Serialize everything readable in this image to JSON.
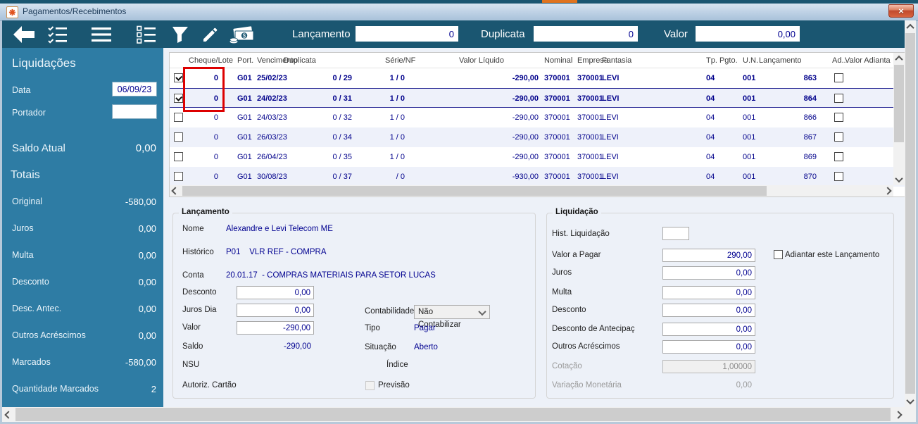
{
  "window": {
    "title": "Pagamentos/Recebimentos",
    "close_glyph": "×"
  },
  "colors": {
    "toolbar_teal": "#1a5671",
    "sidebar_teal": "#2e7ca4",
    "data_navy": "#00008b",
    "annotation_red": "#dd0000",
    "accent_orange": "#e0731e"
  },
  "toolbar": {
    "lancamento_label": "Lançamento",
    "lancamento_value": "0",
    "duplicata_label": "Duplicata",
    "duplicata_value": "0",
    "valor_label": "Valor",
    "valor_value": "0,00"
  },
  "sidebar": {
    "title": "Liquidações",
    "data_label": "Data",
    "data_value": "06/09/23",
    "portador_label": "Portador",
    "portador_value": "",
    "saldo_label": "Saldo Atual",
    "saldo_value": "0,00",
    "totais_title": "Totais",
    "totals": [
      {
        "label": "Original",
        "value": "-580,00"
      },
      {
        "label": "Juros",
        "value": "0,00"
      },
      {
        "label": "Multa",
        "value": "0,00"
      },
      {
        "label": "Desconto",
        "value": "0,00"
      },
      {
        "label": "Desc. Antec.",
        "value": "0,00"
      },
      {
        "label": "Outros Acréscimos",
        "value": "0,00"
      },
      {
        "label": "Marcados",
        "value": "-580,00"
      },
      {
        "label": "Quantidade Marcados",
        "value": "2"
      }
    ]
  },
  "grid": {
    "headers": {
      "cheque": "Cheque/Lote",
      "port": "Port.",
      "venc": "Vencimento",
      "dup": "Duplicata",
      "serie": "Série/NF",
      "valor": "Valor Líquido",
      "nominal": "Nominal",
      "empresa": "Empresa",
      "fantasia": "Fantasia",
      "tp": "Tp. Pgto.",
      "un": "U.N.",
      "lanc": "Lançamento",
      "ad": "Ad...",
      "valad": "Valor Adianta"
    },
    "rows": [
      {
        "checked": true,
        "bold": true,
        "selected": false,
        "cheque": "0",
        "port": "G01",
        "venc": "25/02/23",
        "dup": "0 / 29",
        "serie": "1 / 0",
        "valor": "-290,00",
        "nominal": "370001",
        "empresa": "370001",
        "fantasia": "LEVI",
        "tp": "04",
        "un": "001",
        "lanc": "863"
      },
      {
        "checked": true,
        "bold": true,
        "selected": true,
        "cheque": "0",
        "port": "G01",
        "venc": "24/02/23",
        "dup": "0 / 31",
        "serie": "1 / 0",
        "valor": "-290,00",
        "nominal": "370001",
        "empresa": "370001",
        "fantasia": "LEVI",
        "tp": "04",
        "un": "001",
        "lanc": "864"
      },
      {
        "checked": false,
        "bold": false,
        "selected": false,
        "cheque": "0",
        "port": "G01",
        "venc": "24/03/23",
        "dup": "0 / 32",
        "serie": "1 / 0",
        "valor": "-290,00",
        "nominal": "370001",
        "empresa": "370001",
        "fantasia": "LEVI",
        "tp": "04",
        "un": "001",
        "lanc": "866"
      },
      {
        "checked": false,
        "bold": false,
        "selected": false,
        "cheque": "0",
        "port": "G01",
        "venc": "26/03/23",
        "dup": "0 / 34",
        "serie": "1 / 0",
        "valor": "-290,00",
        "nominal": "370001",
        "empresa": "370001",
        "fantasia": "LEVI",
        "tp": "04",
        "un": "001",
        "lanc": "867"
      },
      {
        "checked": false,
        "bold": false,
        "selected": false,
        "cheque": "0",
        "port": "G01",
        "venc": "26/04/23",
        "dup": "0 / 35",
        "serie": "1 / 0",
        "valor": "-290,00",
        "nominal": "370001",
        "empresa": "370001",
        "fantasia": "LEVI",
        "tp": "04",
        "un": "001",
        "lanc": "869"
      },
      {
        "checked": false,
        "bold": false,
        "selected": false,
        "cheque": "0",
        "port": "G01",
        "venc": "30/08/23",
        "dup": "0 / 37",
        "serie": "/ 0",
        "valor": "-930,00",
        "nominal": "370001",
        "empresa": "370001",
        "fantasia": "LEVI",
        "tp": "04",
        "un": "001",
        "lanc": "870"
      }
    ]
  },
  "lancamento": {
    "title": "Lançamento",
    "nome_label": "Nome",
    "nome_value": "Alexandre e Levi Telecom ME",
    "historico_label": "Histórico",
    "historico_value": "P01    VLR REF - COMPRA",
    "conta_label": "Conta",
    "conta_value": "20.01.17  - COMPRAS MATERIAIS PARA SETOR LUCAS",
    "desconto_label": "Desconto",
    "desconto_value": "0,00",
    "juros_dia_label": "Juros Dia",
    "juros_dia_value": "0,00",
    "valor_label": "Valor",
    "valor_value": "-290,00",
    "saldo_label": "Saldo",
    "saldo_value": "-290,00",
    "nsu_label": "NSU",
    "autoriz_label": "Autoriz. Cartão",
    "contabilidade_label": "Contabilidade",
    "contabilidade_value": "Não Contabilizar",
    "tipo_label": "Tipo",
    "tipo_value": "Pagar",
    "situacao_label": "Situação",
    "situacao_value": "Aberto",
    "indice_label": "Índice",
    "previsao_label": "Previsão"
  },
  "liquidacao": {
    "title": "Liquidação",
    "hist_label": "Hist. Liquidação",
    "hist_value": "",
    "valor_pagar_label": "Valor a Pagar",
    "valor_pagar_value": "290,00",
    "adiantar_label": "Adiantar este Lançamento",
    "juros_label": "Juros",
    "juros_value": "0,00",
    "multa_label": "Multa",
    "multa_value": "0,00",
    "desconto_label": "Desconto",
    "desconto_value": "0,00",
    "desc_antecip_label": "Desconto de Antecipaç",
    "desc_antecip_value": "0,00",
    "outros_label": "Outros Acréscimos",
    "outros_value": "0,00",
    "cotacao_label": "Cotação",
    "cotacao_value": "1,00000",
    "variacao_label": "Variação Monetária",
    "variacao_value": "0,00"
  },
  "annotation": {
    "color": "#dd0000"
  }
}
